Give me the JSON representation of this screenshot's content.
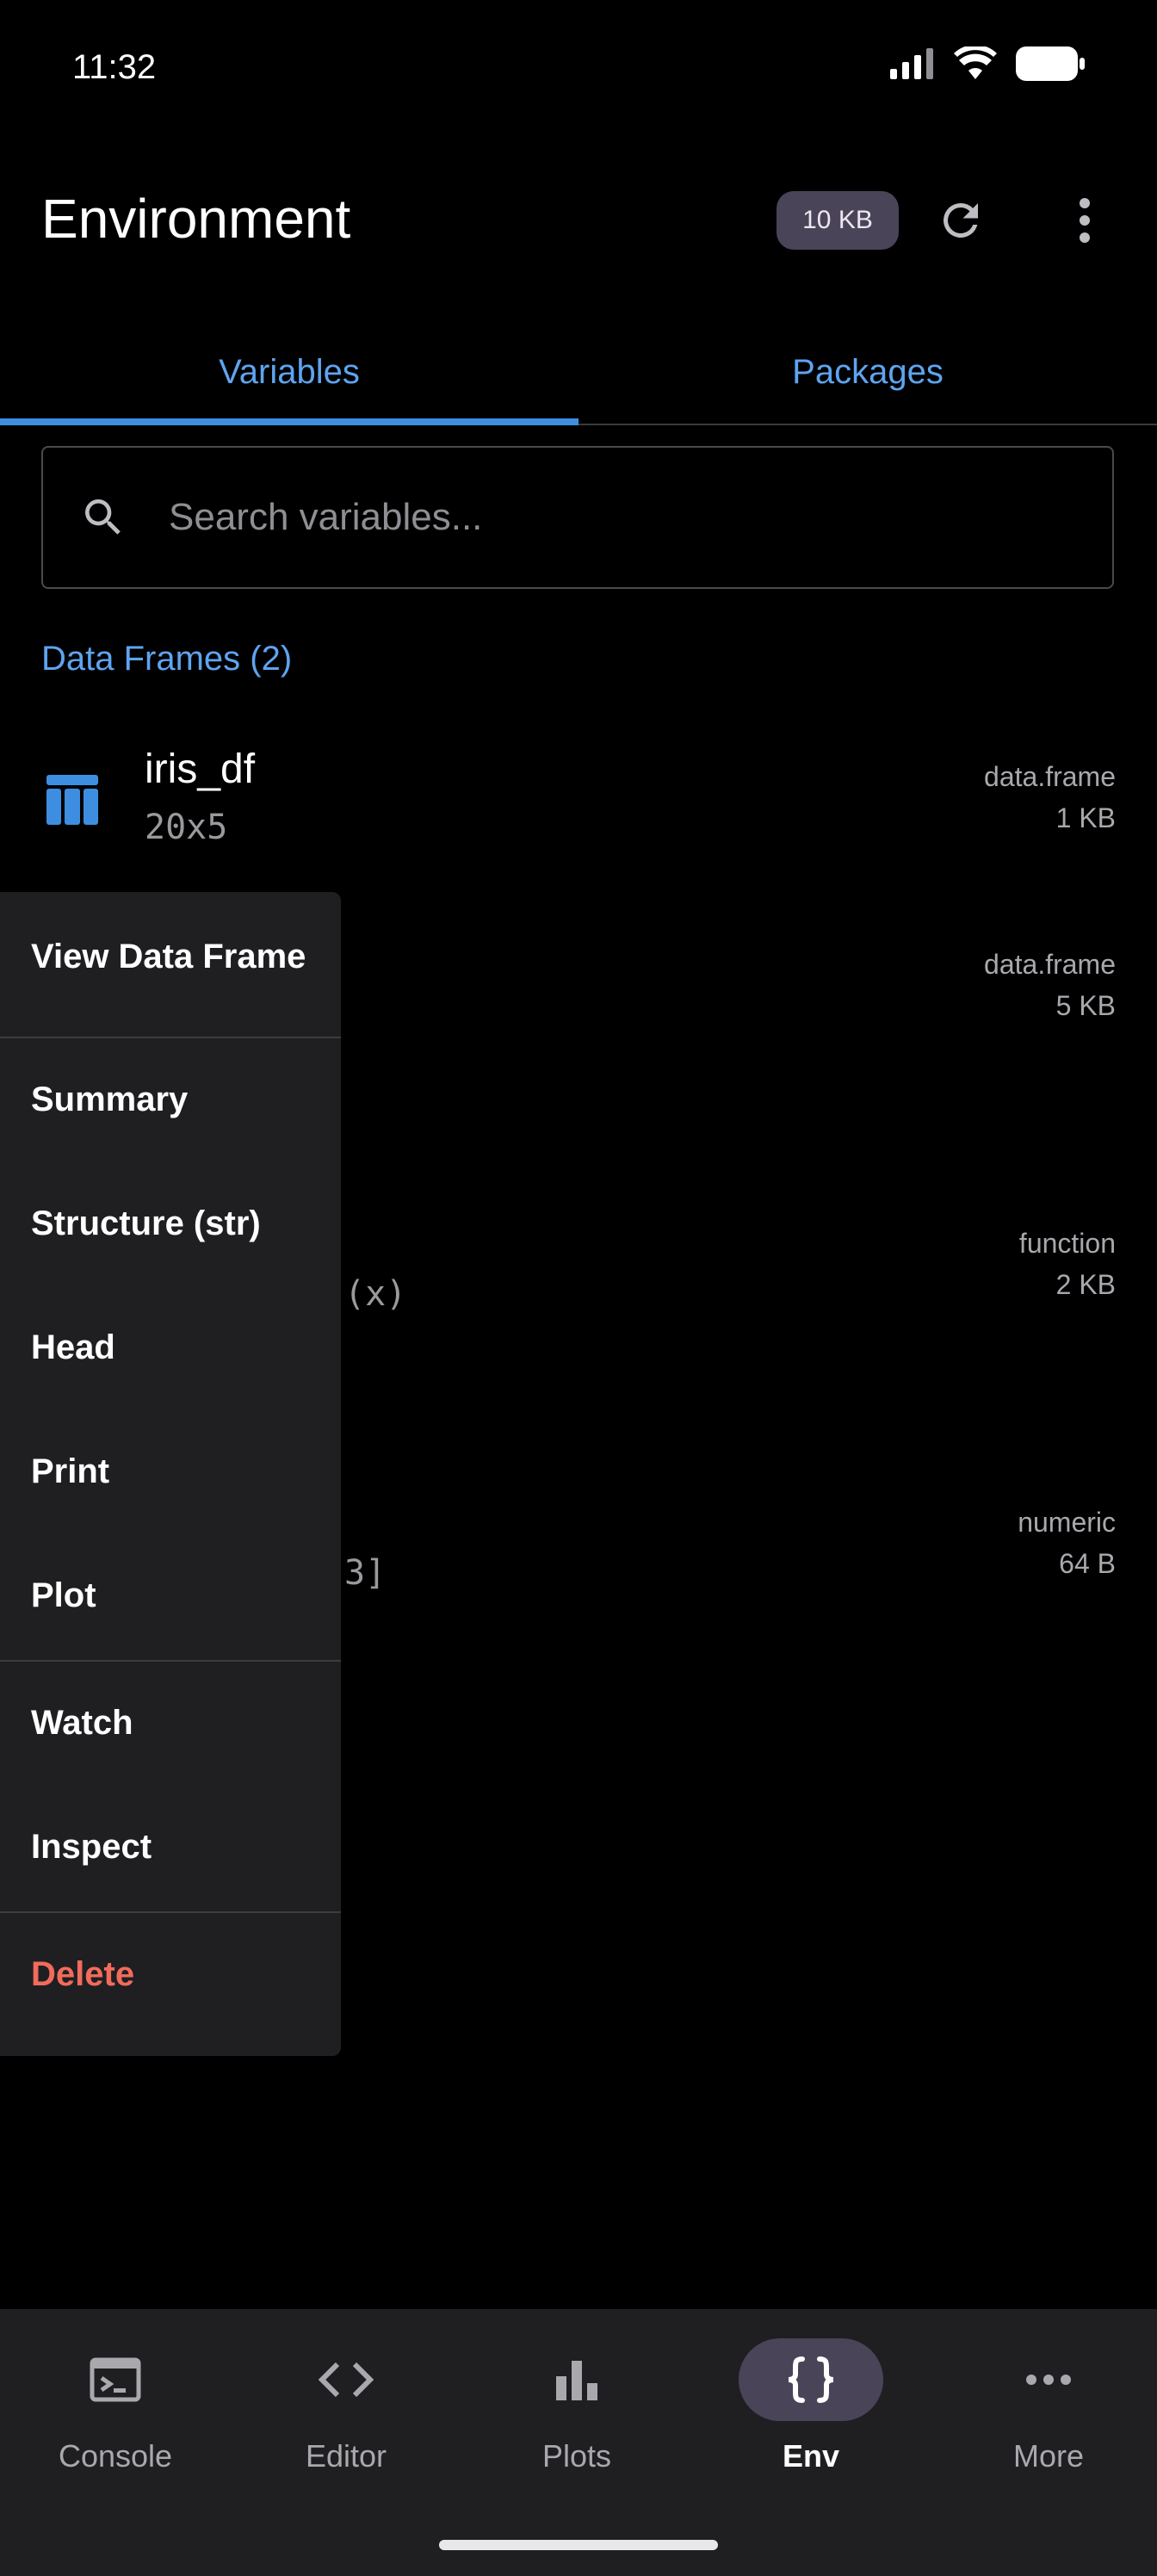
{
  "status_bar": {
    "time": "11:32"
  },
  "app_bar": {
    "title": "Environment",
    "size_chip": "10 KB"
  },
  "tabs": [
    {
      "label": "Variables",
      "active": true
    },
    {
      "label": "Packages",
      "active": false
    }
  ],
  "search": {
    "placeholder": "Search variables...",
    "value": ""
  },
  "section": {
    "label": "Data Frames (2)"
  },
  "variables": [
    {
      "name": "iris_df",
      "dim": "20x5",
      "type": "data.frame",
      "size": "1 KB"
    },
    {
      "name": "",
      "dim": "",
      "type": "data.frame",
      "size": "5 KB"
    },
    {
      "name": "",
      "dim": "(x)",
      "type": "function",
      "size": "2 KB"
    },
    {
      "name": "",
      "dim": "3]",
      "type": "numeric",
      "size": "64 B"
    }
  ],
  "context_menu": {
    "items": [
      {
        "label": "View Data Frame"
      },
      {
        "label": "Summary"
      },
      {
        "label": "Structure (str)"
      },
      {
        "label": "Head"
      },
      {
        "label": "Print"
      },
      {
        "label": "Plot"
      },
      {
        "label": "Watch"
      },
      {
        "label": "Inspect"
      },
      {
        "label": "Delete"
      }
    ]
  },
  "bottom_nav": [
    {
      "label": "Console",
      "icon": "terminal-icon"
    },
    {
      "label": "Editor",
      "icon": "code-icon"
    },
    {
      "label": "Plots",
      "icon": "bar-chart-icon"
    },
    {
      "label": "Env",
      "icon": "braces-icon",
      "active": true
    },
    {
      "label": "More",
      "icon": "more-horizontal-icon"
    }
  ],
  "colors": {
    "accent": "#5ea4f0",
    "danger": "#f26b5b",
    "chip_bg": "#4a4458",
    "surface": "#1f1f22"
  }
}
